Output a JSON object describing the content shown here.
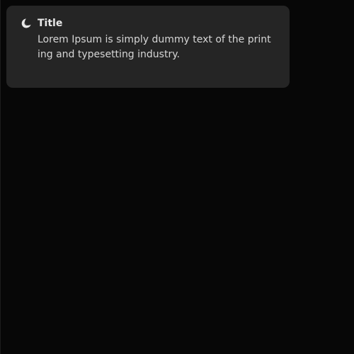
{
  "notification": {
    "icon": "moon-icon",
    "title": "Title",
    "message": "Lorem Ipsum is simply dummy text of the printing and typesetting industry.",
    "colors": {
      "background": "#070707",
      "card": "#252525",
      "title": "#e8e8e8",
      "message": "#d6d6d6"
    }
  }
}
